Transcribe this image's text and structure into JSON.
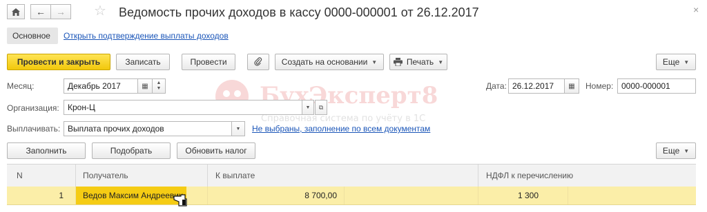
{
  "window": {
    "title": "Ведомость прочих доходов в кассу 0000-000001 от 26.12.2017",
    "close_glyph": "×"
  },
  "nav_tabs": {
    "main": "Основное",
    "link": "Открыть подтверждение выплаты доходов"
  },
  "toolbar": {
    "post_close": "Провести и закрыть",
    "save": "Записать",
    "post": "Провести",
    "create_based": "Создать на основании",
    "print": "Печать",
    "more": "Еще"
  },
  "form": {
    "month_label": "Месяц:",
    "month_value": "Декабрь 2017",
    "date_label": "Дата:",
    "date_value": "26.12.2017",
    "number_label": "Номер:",
    "number_value": "0000-000001",
    "org_label": "Организация:",
    "org_value": "Крон-Ц",
    "pay_label": "Выплачивать:",
    "pay_value": "Выплата прочих доходов",
    "pay_link": "Не выбраны, заполнение по всем документам"
  },
  "table_toolbar": {
    "fill": "Заполнить",
    "pick": "Подобрать",
    "update_tax": "Обновить налог",
    "more": "Еще"
  },
  "table": {
    "columns": [
      "N",
      "Получатель",
      "К выплате",
      "НДФЛ к перечислению"
    ],
    "rows": [
      {
        "n": "1",
        "recipient": "Ведов Максим Андреевич",
        "amount": "8 700,00",
        "tax": "1 300"
      }
    ]
  },
  "watermark": {
    "brand": "БухЭксперт8",
    "tagline": "Справочная система по учёту в 1С"
  },
  "colors": {
    "accent_yellow": "#f5cc14",
    "selected_row": "#fbeea8",
    "link_blue": "#1a55b8"
  }
}
